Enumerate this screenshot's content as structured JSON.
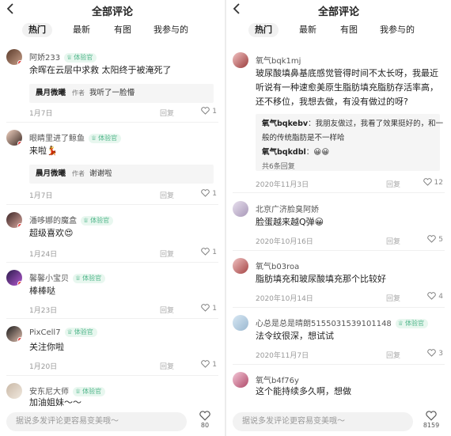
{
  "left": {
    "title": "全部评论",
    "tabs": [
      "热门",
      "最新",
      "有图",
      "我参与的"
    ],
    "comments": [
      {
        "user": "阿娇233",
        "badge": "体验官",
        "text": "余晖在云层中求救 太阳终于被淹死了",
        "reply": {
          "author": "晨月微曦",
          "tag": "作者",
          "text": "我听了一脸懵"
        },
        "date": "1月7日",
        "reply_label": "回复",
        "likes": "1"
      },
      {
        "user": "眼睛里进了鲸鱼",
        "badge": "体验官",
        "text": "来啦💃",
        "reply": {
          "author": "晨月微曦",
          "tag": "作者",
          "text": "谢谢啦"
        },
        "date": "1月7日",
        "reply_label": "回复",
        "likes": "1"
      },
      {
        "user": "潘哆娜的魔盒",
        "badge": "体验官",
        "text": "超级喜欢😍",
        "date": "1月24日",
        "reply_label": "回复",
        "likes": "1"
      },
      {
        "user": "馨馨小宝贝",
        "badge": "体验官",
        "text": "棒棒哒",
        "date": "1月23日",
        "reply_label": "回复",
        "likes": "1"
      },
      {
        "user": "PixCell7",
        "badge": "体验官",
        "text": "关注你啦",
        "date": "1月20日",
        "reply_label": "回复",
        "likes": "1"
      },
      {
        "user": "安东尼大师",
        "badge": "体验官",
        "text": "加油姐妹～～"
      }
    ],
    "input_placeholder": "据说多发评论更容易变美哦～",
    "total_likes": "80"
  },
  "right": {
    "title": "全部评论",
    "tabs": [
      "热门",
      "最新",
      "有图",
      "我参与的"
    ],
    "comments": [
      {
        "user": "氧气bqk1mj",
        "text_lines": [
          "玻尿酸填鼻基底感觉管得时间不太长呀，我最近",
          "听说有一种速愈美原生脂肪填充脂肪存活率高，",
          "还不移位，我想去做，有没有做过的呀?"
        ],
        "replies": [
          {
            "author": "氧气bqkebv",
            "text_lines": [
              "我朋友做过，我看了效果挺好的，和一",
              "般的传统脂肪是不一样哈"
            ]
          },
          {
            "author": "氧气bqkdbl",
            "text": "😀😀"
          }
        ],
        "more_replies": "共6条回复",
        "date": "2020年11月3日",
        "reply_label": "回复",
        "likes": "12"
      },
      {
        "user": "北京广济脸臭阿娇",
        "text": "脸蛋越来越Q弹😀",
        "date": "2020年10月16日",
        "reply_label": "回复",
        "likes": "5"
      },
      {
        "user": "氧气b03roa",
        "text": "脂肪填充和玻尿酸填充那个比较好",
        "date": "2020年10月14日",
        "reply_label": "回复",
        "likes": "4"
      },
      {
        "user": "心总是总是晴朗5155031539101148",
        "badge": "体验官",
        "text": "法令纹很深，想试试",
        "date": "2020年11月7日",
        "reply_label": "回复",
        "likes": "3"
      },
      {
        "user": "氧气b4f76y",
        "text": "这个能持续多久啊，想做"
      }
    ],
    "input_placeholder": "据说多发评论更容易变美哦～",
    "total_likes": "8159"
  },
  "colors": {
    "badge_text": "#4fb58a",
    "badge_bg": "#e8f7ef",
    "accent_dot": "#e63b3b",
    "tab_active_bg": "#f1f1f1",
    "reply_bg": "#f5f5f5"
  },
  "icons": {
    "back": "chevron-left-icon",
    "like": "heart-outline-icon",
    "badge": "crown-icon"
  }
}
